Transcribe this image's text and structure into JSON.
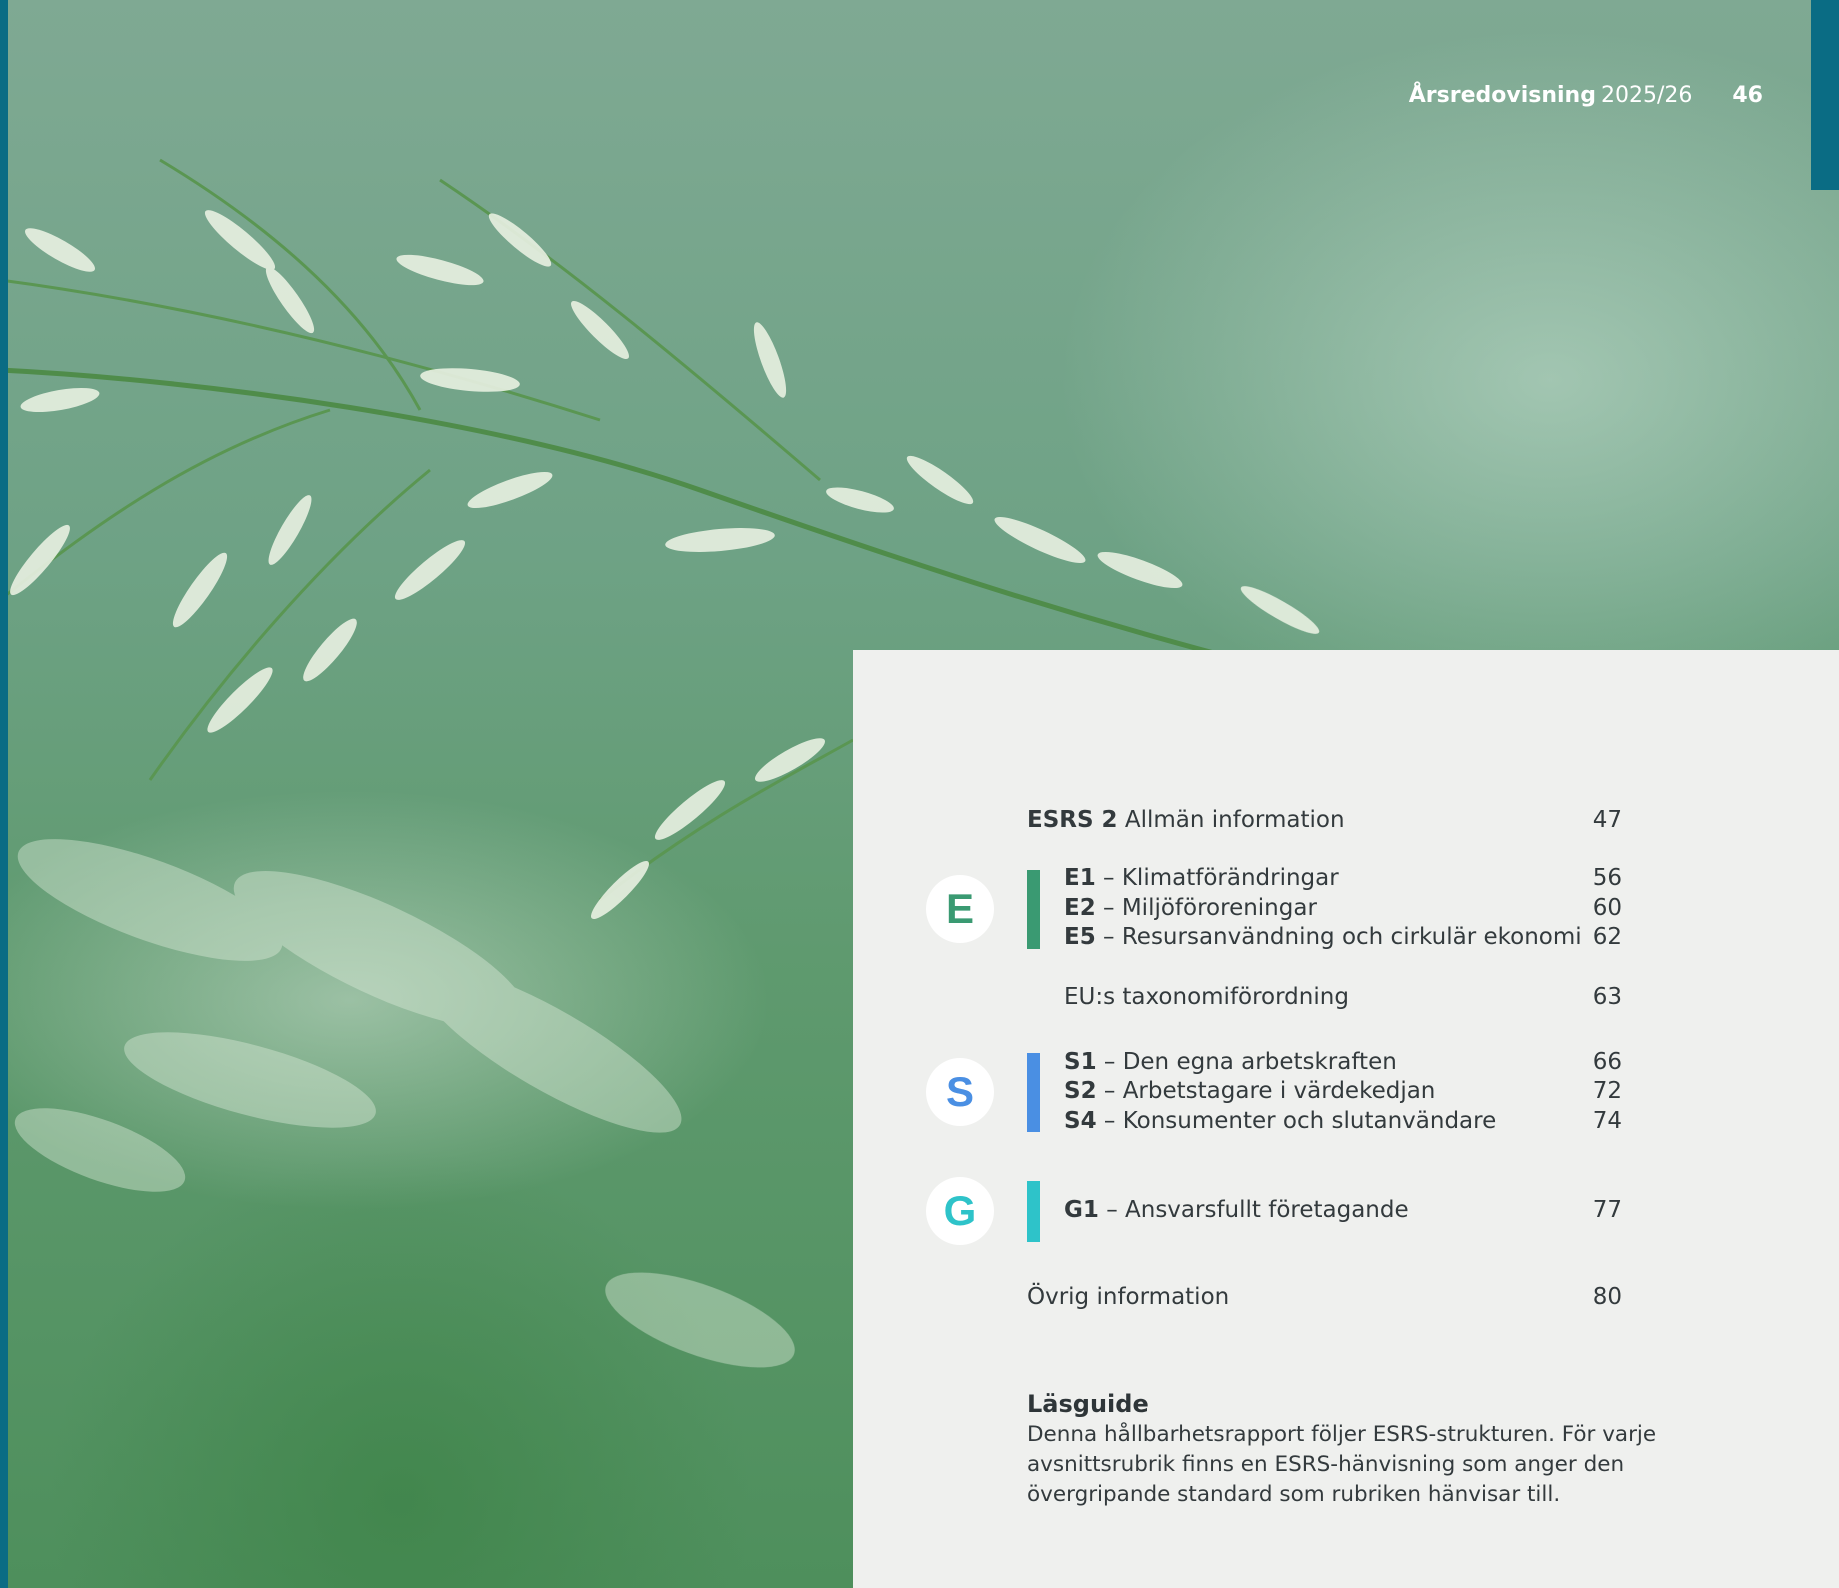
{
  "header": {
    "report_title": "Årsredovisning",
    "report_year": "2025/26",
    "page_number": "46"
  },
  "toc": {
    "esrs2": {
      "code": "ESRS 2",
      "title": "Allmän information",
      "page": "47"
    },
    "environment": {
      "letter": "E",
      "color": "#3a9a72",
      "items": [
        {
          "code": "E1",
          "title": " – Klimatförändringar",
          "page": "56"
        },
        {
          "code": "E2",
          "title": " – Miljöföroreningar",
          "page": "60"
        },
        {
          "code": "E5",
          "title": " – Resursanvändning och cirkulär ekonomi",
          "page": "62"
        }
      ]
    },
    "taxonomy": {
      "title": "EU:s taxonomiförordning",
      "page": "63"
    },
    "social": {
      "letter": "S",
      "color": "#4a8fe3",
      "items": [
        {
          "code": "S1",
          "title": " – Den egna arbetskraften",
          "page": "66"
        },
        {
          "code": "S2",
          "title": " – Arbetstagare i värdekedjan",
          "page": "72"
        },
        {
          "code": "S4",
          "title": " – Konsumenter och slutanvändare",
          "page": "74"
        }
      ]
    },
    "governance": {
      "letter": "G",
      "color": "#2ec3c9",
      "items": [
        {
          "code": "G1",
          "title": " – Ansvarsfullt företagande",
          "page": "77"
        }
      ]
    },
    "other": {
      "title": "Övrig information",
      "page": "80"
    }
  },
  "reading_guide": {
    "title": "Läsguide",
    "text": "Denna hållbarhetsrapport följer ESRS-strukturen. För varje avsnittsrubrik finns en ESRS-hänvisning som anger den övergripande standard som rubriken hänvisar till."
  },
  "colors": {
    "accent_blue": "#0a6c84",
    "panel_background": "#eff0ee"
  }
}
